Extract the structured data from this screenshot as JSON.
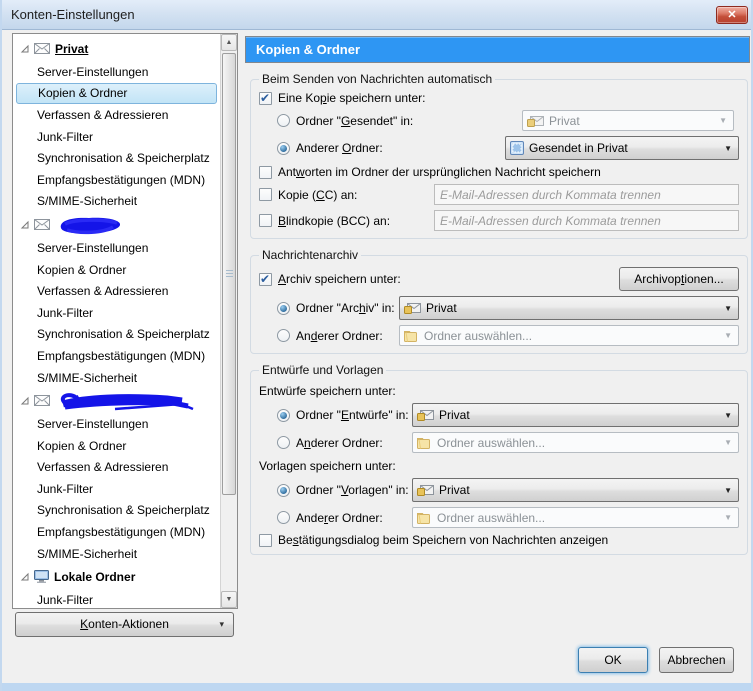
{
  "window": {
    "title": "Konten-Einstellungen"
  },
  "icons": {
    "combo_arrow": "▼",
    "dropmark": "▾",
    "scroll_up": "▲",
    "scroll_down": "▼",
    "close": "✕"
  },
  "colors": {
    "header_blue": "#2e96f3",
    "selection_blue": "#c2e4f6",
    "close_red": "#c44f3a",
    "scribble_blue": "#1414e8"
  },
  "sidebar": {
    "accounts": [
      {
        "name": "Privat",
        "redacted": false,
        "items": [
          "Server-Einstellungen",
          "Kopien & Ordner",
          "Verfassen & Adressieren",
          "Junk-Filter",
          "Synchronisation & Speicherplatz",
          "Empfangsbestätigungen (MDN)",
          "S/MIME-Sicherheit"
        ],
        "selected_item": "Kopien & Ordner"
      },
      {
        "name": "",
        "redacted": true,
        "items": [
          "Server-Einstellungen",
          "Kopien & Ordner",
          "Verfassen & Adressieren",
          "Junk-Filter",
          "Synchronisation & Speicherplatz",
          "Empfangsbestätigungen (MDN)",
          "S/MIME-Sicherheit"
        ]
      },
      {
        "name": "",
        "redacted": true,
        "items": [
          "Server-Einstellungen",
          "Kopien & Ordner",
          "Verfassen & Adressieren",
          "Junk-Filter",
          "Synchronisation & Speicherplatz",
          "Empfangsbestätigungen (MDN)",
          "S/MIME-Sicherheit"
        ]
      },
      {
        "name": "Lokale Ordner",
        "redacted": false,
        "items": [
          "Junk-Filter"
        ]
      }
    ],
    "actions_button": {
      "label": "Konten-Aktionen",
      "accesskey": "K"
    }
  },
  "panel": {
    "header": "Kopien & Ordner",
    "sending": {
      "legend": "Beim Senden von Nachrichten automatisch",
      "save_copy": {
        "label": "Eine Kopie speichern unter:",
        "accesskey": "p",
        "checked": true
      },
      "sent_folder": {
        "label": "Ordner \"Gesendet\" in:",
        "accesskey": "G",
        "selected": false,
        "value": "Privat",
        "disabled": true
      },
      "other_folder": {
        "label": "Anderer Ordner:",
        "accesskey": "O",
        "selected": true,
        "value": "Gesendet in Privat",
        "disabled": false
      },
      "reply_in_origin": {
        "label": "Antworten im Ordner der ursprünglichen Nachricht speichern",
        "accesskey": "w",
        "checked": false
      },
      "cc": {
        "label": "Kopie (CC) an:",
        "accesskey": "C",
        "checked": false,
        "placeholder": "E-Mail-Adressen durch Kommata trennen"
      },
      "bcc": {
        "label": "Blindkopie (BCC) an:",
        "accesskey": "B",
        "checked": false,
        "placeholder": "E-Mail-Adressen durch Kommata trennen"
      }
    },
    "archive": {
      "legend": "Nachrichtenarchiv",
      "keep_archive": {
        "label": "Archiv speichern unter:",
        "accesskey": "A",
        "checked": true
      },
      "options_button": {
        "label": "Archivoptionen...",
        "accesskey": "t"
      },
      "archive_folder": {
        "label": "Ordner \"Archiv\" in:",
        "accesskey": "h",
        "selected": true,
        "value": "Privat",
        "disabled": false
      },
      "other_folder": {
        "label": "Anderer Ordner:",
        "accesskey": "d",
        "selected": false,
        "value": "Ordner auswählen...",
        "disabled": true
      }
    },
    "drafts_templates": {
      "legend": "Entwürfe und Vorlagen",
      "drafts_caption": "Entwürfe speichern unter:",
      "drafts_folder": {
        "label": "Ordner \"Entwürfe\" in:",
        "accesskey": "E",
        "selected": true,
        "value": "Privat",
        "disabled": false
      },
      "drafts_other": {
        "label": "Anderer Ordner:",
        "accesskey": "n",
        "selected": false,
        "value": "Ordner auswählen...",
        "disabled": true
      },
      "templates_caption": "Vorlagen speichern unter:",
      "templates_folder": {
        "label": "Ordner \"Vorlagen\" in:",
        "accesskey": "V",
        "selected": true,
        "value": "Privat",
        "disabled": false
      },
      "templates_other": {
        "label": "Anderer Ordner:",
        "accesskey": "r",
        "selected": false,
        "value": "Ordner auswählen...",
        "disabled": true
      },
      "confirm_dialog": {
        "label": "Bestätigungsdialog beim Speichern von Nachrichten anzeigen",
        "accesskey": "s",
        "checked": false
      }
    },
    "buttons": {
      "ok": "OK",
      "cancel": "Abbrechen"
    }
  }
}
